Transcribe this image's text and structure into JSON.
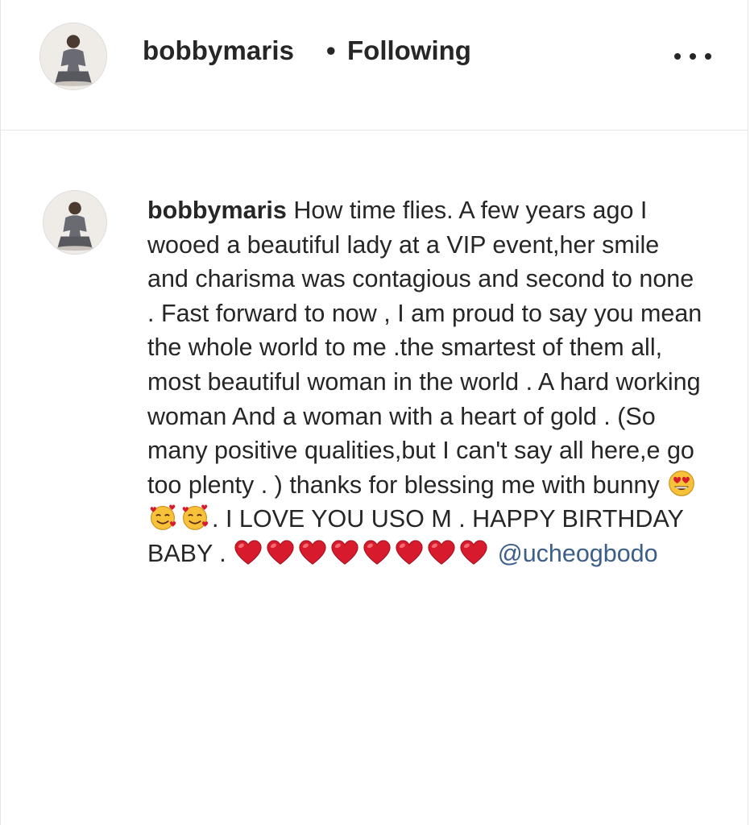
{
  "post": {
    "author": "bobbymaris",
    "separator": "•",
    "follow_status": "Following",
    "more_icon": "more-horizontal-icon"
  },
  "caption": {
    "username": "bobbymaris",
    "text_1": " How time flies. A few years ago I wooed a beautiful lady at a VIP event,her smile and charisma was contagious and second to none . Fast forward to now , I am proud to say you mean the whole world to me .the smartest of them all, most beautiful woman in the world . A hard working woman And a woman with a heart of gold . (So many positive qualities,but I can't say all here,e go too plenty . ) thanks for blessing me with bunny ",
    "text_2": ". I LOVE YOU USO M . HAPPY BIRTHDAY BABY . ",
    "mention": "@ucheogbodo",
    "emojis": [
      "heart-eyes-emoji",
      "smiling-face-with-hearts-emoji",
      "red-heart-emoji"
    ],
    "colors": {
      "heart": "#d81b2c",
      "emoji_face": "#f7c13a",
      "mention": "#3c5e8a"
    }
  }
}
